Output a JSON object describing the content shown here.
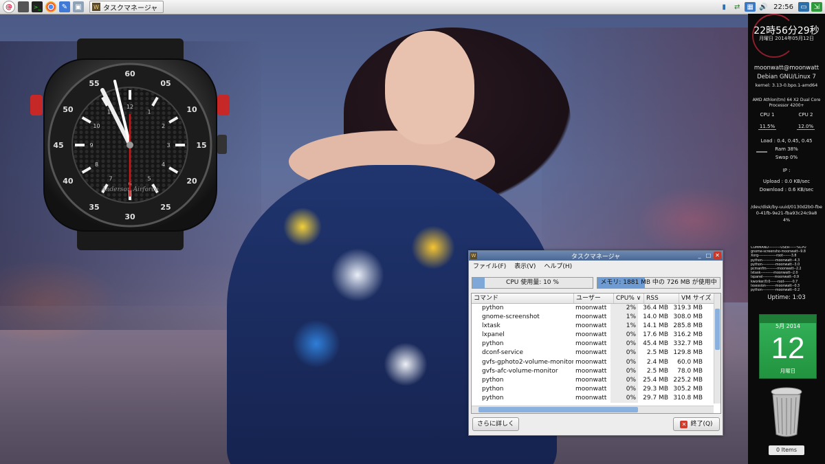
{
  "taskbar": {
    "task_button_label": "タスクマネージャ",
    "clock": "22:56"
  },
  "conky": {
    "time": "22時56分29秒",
    "date": "月曜日 2014年05月12日",
    "user": "moonwatt@moonwatt",
    "os": "Debian GNU/Linux 7",
    "kernel": "kernel: 3.13-0.bpo.1-amd64",
    "cpu_model": "AMD Athlon(tm) 64 X2 Dual Core Processor 4200+",
    "cpu1_label": "CPU 1",
    "cpu2_label": "CPU 2",
    "cpu1_value": "11.5%",
    "cpu2_value": "12.0%",
    "load": "Load : 0.4, 0.45, 0.45",
    "ram": "Ram 38%",
    "swap": "Swap 0%",
    "ip": "IP :",
    "upload": "Upload : 0.0 KB/sec",
    "download": "Download : 0.6 KB/sec",
    "disk": "/dev/disk/by-uuid/0130d2b0-fbe0-41fb-9e21-fba93c24c9a8",
    "disk_pct": "4%",
    "procs": [
      "COMMAND----------USER------%CPU",
      "gnome-screensho-moonwatt--9.8",
      "Xorg---------------root-------3.8",
      "python-----------moonwatt--4.3",
      "python-----------moonwatt--3.0",
      "pcmanfm---------moonwatt--2.2",
      "lxtask-----------moonwatt--2.0",
      "lxpanel----------moonwatt--0.9",
      "kworker/0:0------root-------0.7",
      "lxsession--------moonwatt--0.3",
      "python-----------moonwatt--0.2"
    ],
    "uptime": "Uptime: 1:03"
  },
  "calendar": {
    "month": "5月 2014",
    "day": "12",
    "weekday": "月曜日"
  },
  "trash": {
    "label": "0 Items"
  },
  "taskmgr": {
    "title": "タスクマネージャ",
    "menu": [
      "ファイル(F)",
      "表示(V)",
      "ヘルプ(H)"
    ],
    "cpu_label": "CPU 使用量: 10 %",
    "cpu_fraction": 0.1,
    "mem_label": "メモリ: 1881 MB 中の 726 MB が使用中",
    "mem_fraction": 0.386,
    "columns": [
      "コマンド",
      "ユーザー",
      "CPU% ∨",
      "RSS",
      "VM サイズ"
    ],
    "rows": [
      [
        "python",
        "moonwatt",
        "2%",
        "36.4 MB",
        "319.3 MB"
      ],
      [
        "gnome-screenshot",
        "moonwatt",
        "1%",
        "14.0 MB",
        "308.0 MB"
      ],
      [
        "lxtask",
        "moonwatt",
        "1%",
        "14.1 MB",
        "285.8 MB"
      ],
      [
        "lxpanel",
        "moonwatt",
        "0%",
        "17.6 MB",
        "316.2 MB"
      ],
      [
        "python",
        "moonwatt",
        "0%",
        "45.4 MB",
        "332.7 MB"
      ],
      [
        "dconf-service",
        "moonwatt",
        "0%",
        "2.5 MB",
        "129.8 MB"
      ],
      [
        "gvfs-gphoto2-volume-monitor",
        "moonwatt",
        "0%",
        "2.4 MB",
        "60.0 MB"
      ],
      [
        "gvfs-afc-volume-monitor",
        "moonwatt",
        "0%",
        "2.5 MB",
        "78.0 MB"
      ],
      [
        "python",
        "moonwatt",
        "0%",
        "25.4 MB",
        "225.2 MB"
      ],
      [
        "python",
        "moonwatt",
        "0%",
        "29.3 MB",
        "305.2 MB"
      ],
      [
        "python",
        "moonwatt",
        "0%",
        "29.7 MB",
        "310.8 MB"
      ]
    ],
    "more_button": "さらに詳しく",
    "quit_button": "終了(Q)"
  },
  "watch": {
    "brand": "Anderson Airforce",
    "hours": [
      "12",
      "1",
      "2",
      "3",
      "4",
      "5",
      "6",
      "7",
      "8",
      "9",
      "10",
      "11"
    ],
    "minute_labels": [
      "60",
      "05",
      "10",
      "15",
      "20",
      "25",
      "30",
      "35",
      "40",
      "45",
      "50",
      "55"
    ]
  }
}
